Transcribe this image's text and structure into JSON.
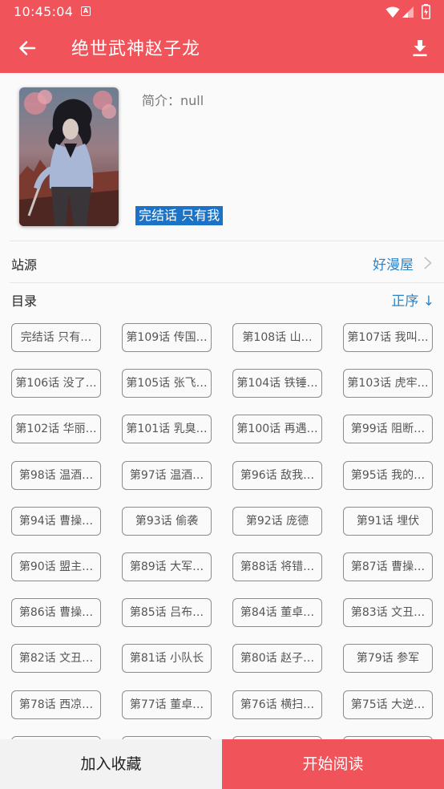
{
  "status_bar": {
    "time": "10:45:04",
    "notification_icon": "a-icon"
  },
  "app_bar": {
    "title": "绝世武神赵子龙"
  },
  "info": {
    "intro": "简介：null",
    "status_tag": "完结话 只有我"
  },
  "source": {
    "label": "站源",
    "value": "好漫屋"
  },
  "catalog": {
    "label": "目录",
    "sort_label": "正序 ↓"
  },
  "chapters": [
    "完结话 只有…",
    "第109话 传国…",
    "第108话 山…",
    "第107话 我叫…",
    "第106话 没了…",
    "第105话 张飞…",
    "第104话 铁锤…",
    "第103话 虎牢…",
    "第102话 华丽…",
    "第101话 乳臭…",
    "第100话 再遇…",
    "第99话 阻断…",
    "第98话 温酒…",
    "第97话 温酒…",
    "第96话 敌我…",
    "第95话 我的…",
    "第94话 曹操…",
    "第93话 偷袭",
    "第92话 庞德",
    "第91话 埋伏",
    "第90话 盟主…",
    "第89话 大军…",
    "第88话 将错…",
    "第87话 曹操…",
    "第86话 曹操…",
    "第85话 吕布…",
    "第84话 董卓…",
    "第83话 文丑…",
    "第82话 文丑…",
    "第81话 小队长",
    "第80话 赵子…",
    "第79话 参军",
    "第78话 西凉…",
    "第77话 董卓…",
    "第76话 横扫…",
    "第75话 大逆…",
    "",
    "",
    "",
    ""
  ],
  "buttons": {
    "favorite": "加入收藏",
    "start_reading": "开始阅读"
  },
  "colors": {
    "primary": "#f0545a",
    "accent_blue": "#2c84c7",
    "tag_blue": "#1a73c6"
  }
}
